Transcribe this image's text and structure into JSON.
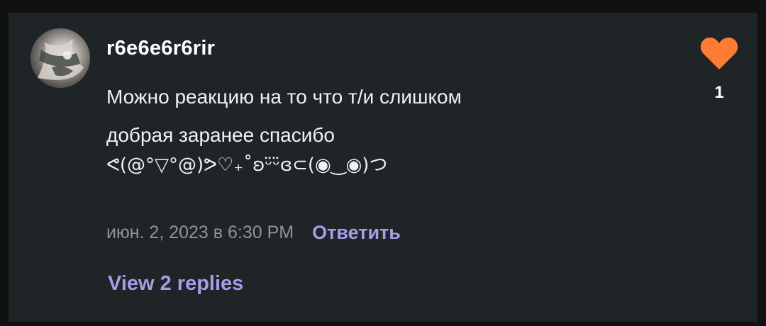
{
  "comment": {
    "username": "r6e6e6r6rir",
    "text_lines": [
      "Можно реакцию на то что т/и слишком",
      "добрая заранее спасибо",
      "ᕙ(@°▽°@)ᕗ♡₊˚ʚᵕ̈ᵕ̈ɞ⊂(◉‿◉)つ"
    ],
    "timestamp": "июн. 2, 2023 в 6:30 PM",
    "reply_label": "Ответить",
    "view_replies_label": "View 2 replies",
    "like_count": "1",
    "icons": {
      "avatar": "user-avatar",
      "like": "heart-icon"
    },
    "colors": {
      "card_background": "#1f2427",
      "heart": "#ff7a33",
      "link": "#a99be8",
      "timestamp": "#8e9497"
    }
  }
}
